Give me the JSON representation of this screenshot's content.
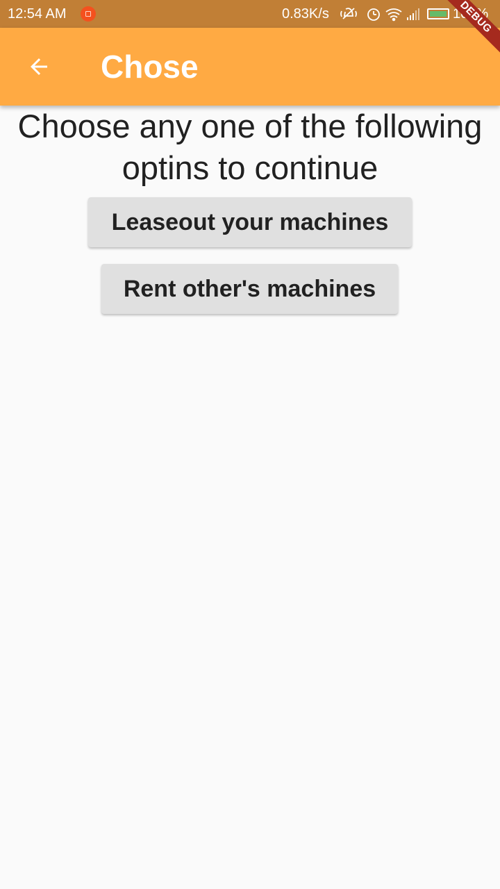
{
  "status_bar": {
    "time": "12:54 AM",
    "net_speed": "0.83K/s",
    "battery_percent": "100%",
    "icons": [
      "notification-icon",
      "vibrate-off-icon",
      "alarm-icon",
      "wifi-icon",
      "signal-icon",
      "battery-icon"
    ]
  },
  "app_bar": {
    "title": "Chose",
    "back_icon": "arrow-back-icon",
    "debug_banner": "DEBUG",
    "color": "#ffaa43"
  },
  "main": {
    "prompt": "Choose any one of the following optins to continue",
    "buttons": [
      {
        "label": "Leaseout your machines"
      },
      {
        "label": "Rent other's machines"
      }
    ]
  },
  "colors": {
    "status_bar": "#c17f36",
    "app_bar": "#ffaa43",
    "background": "#fafafa",
    "button": "#e0e0e0",
    "debug_banner": "#a52a1e"
  }
}
